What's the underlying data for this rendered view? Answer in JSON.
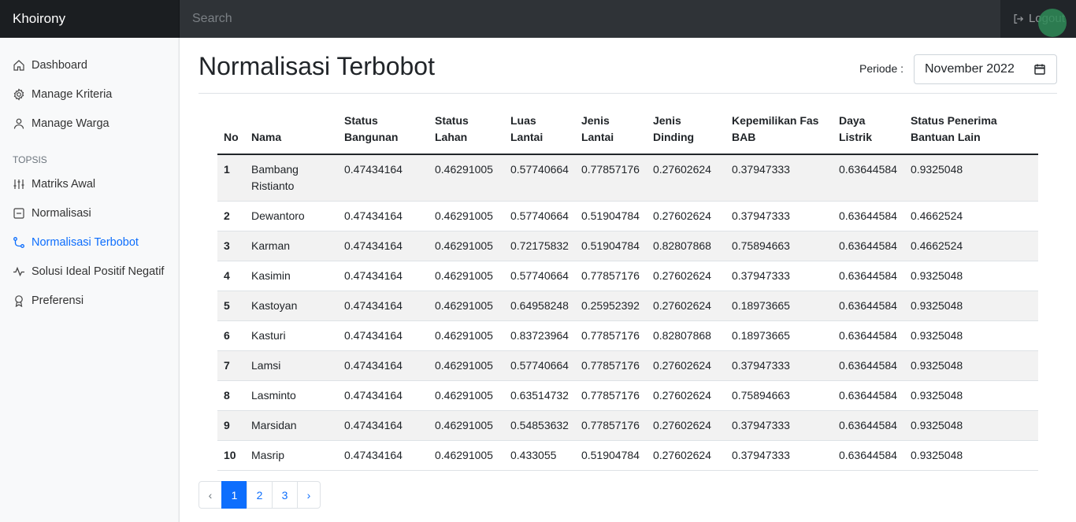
{
  "navbar": {
    "brand": "Khoirony",
    "search_placeholder": "Search",
    "logout_label": "Logout"
  },
  "sidebar": {
    "items": [
      {
        "label": "Dashboard",
        "icon": "home-icon"
      },
      {
        "label": "Manage Kriteria",
        "icon": "gear-icon"
      },
      {
        "label": "Manage Warga",
        "icon": "person-icon"
      }
    ],
    "heading": "TOPSIS",
    "topsis_items": [
      {
        "label": "Matriks Awal",
        "icon": "sliders-icon",
        "active": false
      },
      {
        "label": "Normalisasi",
        "icon": "document-icon",
        "active": false
      },
      {
        "label": "Normalisasi Terbobot",
        "icon": "route-icon",
        "active": true
      },
      {
        "label": "Solusi Ideal Positif Negatif",
        "icon": "activity-icon",
        "active": false
      },
      {
        "label": "Preferensi",
        "icon": "award-icon",
        "active": false
      }
    ]
  },
  "main": {
    "title": "Normalisasi Terbobot",
    "periode_label": "Periode :",
    "periode_value": "November 2022"
  },
  "table": {
    "headers": [
      [
        "No"
      ],
      [
        "Nama"
      ],
      [
        "Status",
        "Bangunan"
      ],
      [
        "Status",
        "Lahan"
      ],
      [
        "Luas",
        "Lantai"
      ],
      [
        "Jenis",
        "Lantai"
      ],
      [
        "Jenis",
        "Dinding"
      ],
      [
        "Kepemilikan Fas",
        "BAB"
      ],
      [
        "Daya",
        "Listrik"
      ],
      [
        "Status Penerima",
        "Bantuan Lain"
      ]
    ],
    "rows": [
      [
        "1",
        "Bambang Ristianto",
        "0.47434164",
        "0.46291005",
        "0.57740664",
        "0.77857176",
        "0.27602624",
        "0.37947333",
        "0.63644584",
        "0.9325048"
      ],
      [
        "2",
        "Dewantoro",
        "0.47434164",
        "0.46291005",
        "0.57740664",
        "0.51904784",
        "0.27602624",
        "0.37947333",
        "0.63644584",
        "0.4662524"
      ],
      [
        "3",
        "Karman",
        "0.47434164",
        "0.46291005",
        "0.72175832",
        "0.51904784",
        "0.82807868",
        "0.75894663",
        "0.63644584",
        "0.4662524"
      ],
      [
        "4",
        "Kasimin",
        "0.47434164",
        "0.46291005",
        "0.57740664",
        "0.77857176",
        "0.27602624",
        "0.37947333",
        "0.63644584",
        "0.9325048"
      ],
      [
        "5",
        "Kastoyan",
        "0.47434164",
        "0.46291005",
        "0.64958248",
        "0.25952392",
        "0.27602624",
        "0.18973665",
        "0.63644584",
        "0.9325048"
      ],
      [
        "6",
        "Kasturi",
        "0.47434164",
        "0.46291005",
        "0.83723964",
        "0.77857176",
        "0.82807868",
        "0.18973665",
        "0.63644584",
        "0.9325048"
      ],
      [
        "7",
        "Lamsi",
        "0.47434164",
        "0.46291005",
        "0.57740664",
        "0.77857176",
        "0.27602624",
        "0.37947333",
        "0.63644584",
        "0.9325048"
      ],
      [
        "8",
        "Lasminto",
        "0.47434164",
        "0.46291005",
        "0.63514732",
        "0.77857176",
        "0.27602624",
        "0.75894663",
        "0.63644584",
        "0.9325048"
      ],
      [
        "9",
        "Marsidan",
        "0.47434164",
        "0.46291005",
        "0.54853632",
        "0.77857176",
        "0.27602624",
        "0.37947333",
        "0.63644584",
        "0.9325048"
      ],
      [
        "10",
        "Masrip",
        "0.47434164",
        "0.46291005",
        "0.433055",
        "0.51904784",
        "0.27602624",
        "0.37947333",
        "0.63644584",
        "0.9325048"
      ]
    ]
  },
  "pagination": {
    "prev": "‹",
    "pages": [
      "1",
      "2",
      "3"
    ],
    "active_page": "1",
    "next": "›"
  },
  "colors": {
    "navbar": "#212529",
    "accent": "#0d6efd",
    "sidebar_bg": "#f8f9fa",
    "row_stripe": "#f2f2f2"
  }
}
